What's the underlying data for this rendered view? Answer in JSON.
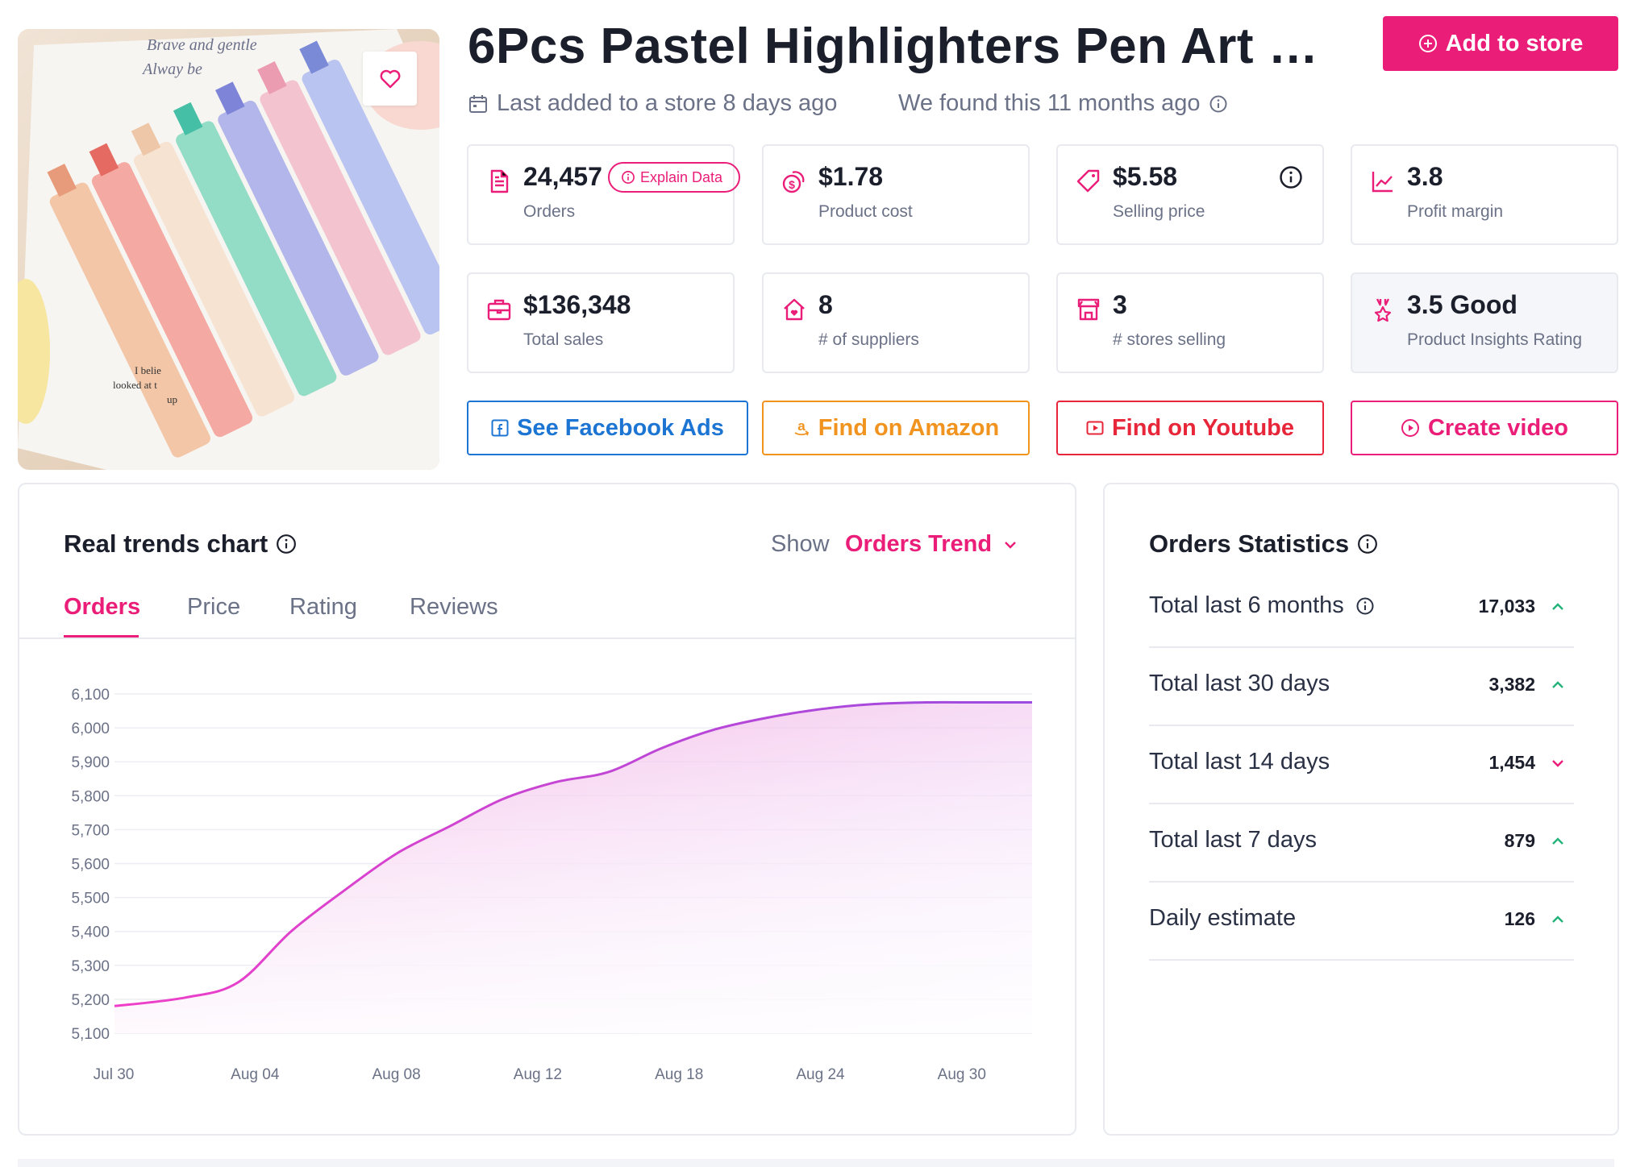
{
  "product": {
    "title": "6Pcs Pastel Highlighters Pen Art D...",
    "image_note_text": [
      "Brave and gentle",
      "Alway  be",
      "I belie",
      "looked at t",
      "up"
    ],
    "last_added": "Last added to a store 8 days ago",
    "found": "We found this 11 months ago"
  },
  "actions": {
    "add_to_store": "Add to store",
    "facebook": "See Facebook Ads",
    "amazon": "Find on Amazon",
    "youtube": "Find on Youtube",
    "create_video": "Create video"
  },
  "stats": {
    "orders": {
      "value": "24,457",
      "label": "Orders",
      "badge": "Explain Data"
    },
    "product_cost": {
      "value": "$1.78",
      "label": "Product cost"
    },
    "selling_price": {
      "value": "$5.58",
      "label": "Selling price"
    },
    "profit_margin": {
      "value": "3.8",
      "label": "Profit margin"
    },
    "total_sales": {
      "value": "$136,348",
      "label": "Total sales"
    },
    "suppliers": {
      "value": "8",
      "label": "# of suppliers"
    },
    "stores_selling": {
      "value": "3",
      "label": "# stores selling"
    },
    "rating": {
      "value": "3.5 Good",
      "label": "Product Insights Rating"
    }
  },
  "trends": {
    "title": "Real trends chart",
    "show_label": "Show",
    "show_value": "Orders Trend",
    "tabs": [
      "Orders",
      "Price",
      "Rating",
      "Reviews"
    ],
    "active_tab": "Orders"
  },
  "chart_data": {
    "type": "area",
    "title": "",
    "xlabel": "",
    "ylabel": "",
    "ylim": [
      5100,
      6100
    ],
    "y_ticks": [
      "6,100",
      "6,000",
      "5,900",
      "5,800",
      "5,700",
      "5,600",
      "5,500",
      "5,400",
      "5,300",
      "5,200",
      "5,100"
    ],
    "x_ticks": [
      "Jul 30",
      "Aug 04",
      "Aug 08",
      "Aug 12",
      "Aug 18",
      "Aug 24",
      "Aug 30"
    ],
    "x": [
      "Jul 30",
      "Aug 01",
      "Aug 02",
      "Aug 04",
      "Aug 06",
      "Aug 08",
      "Aug 10",
      "Aug 12",
      "Aug 14",
      "Aug 16",
      "Aug 18",
      "Aug 20",
      "Aug 22",
      "Aug 24",
      "Aug 26",
      "Aug 28",
      "Aug 30",
      "Sep 01"
    ],
    "series": [
      {
        "values": [
          5180,
          5205,
          5250,
          5400,
          5520,
          5630,
          5710,
          5790,
          5840,
          5870,
          5940,
          5995,
          6030,
          6055,
          6070,
          6075,
          6075,
          6075
        ]
      }
    ],
    "grid": true,
    "colors": {
      "line_start": "#f03fc8",
      "line_end": "#9a4be0",
      "fill_start": "#f6b6e2",
      "fill_end": "#ead4ff"
    }
  },
  "orders_statistics": {
    "title": "Orders Statistics",
    "rows": [
      {
        "label": "Total last 6 months",
        "value": "17,033",
        "trend": "up",
        "info": true
      },
      {
        "label": "Total last 30 days",
        "value": "3,382",
        "trend": "up",
        "info": false
      },
      {
        "label": "Total last 14 days",
        "value": "1,454",
        "trend": "down",
        "info": false
      },
      {
        "label": "Total last 7 days",
        "value": "879",
        "trend": "up",
        "info": false
      },
      {
        "label": "Daily estimate",
        "value": "126",
        "trend": "up",
        "info": false
      }
    ]
  },
  "colors": {
    "accent": "#ea1e78",
    "facebook": "#1c75d3",
    "amazon": "#f0941f",
    "youtube": "#e7263a",
    "up": "#23b37a",
    "down": "#ea1e78"
  },
  "icons": [
    "heart-icon",
    "plus-circle-icon",
    "calendar-icon",
    "info-icon",
    "document-icon",
    "coins-icon",
    "tag-icon",
    "chart-line-icon",
    "briefcase-icon",
    "house-heart-icon",
    "store-icon",
    "award-icon",
    "facebook-icon",
    "amazon-icon",
    "youtube-icon",
    "play-circle-icon",
    "chevron-down-icon",
    "chevron-up-icon"
  ]
}
